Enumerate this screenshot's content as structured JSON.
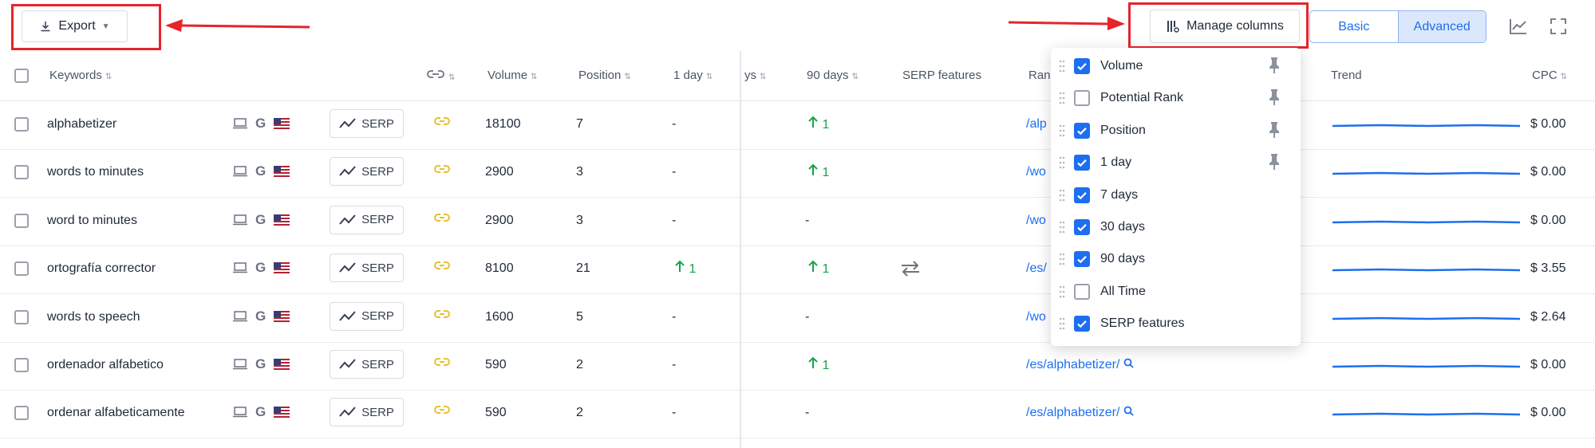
{
  "toolbar": {
    "export_label": "Export",
    "manage_columns_label": "Manage columns",
    "mode_basic": "Basic",
    "mode_advanced": "Advanced",
    "accent": "#1d6ef0"
  },
  "headers": {
    "keywords": "Keywords",
    "volume": "Volume",
    "position": "Position",
    "day1": "1 day",
    "days_partial": "ys",
    "days90": "90 days",
    "serp_features": "SERP features",
    "rank_partial": "Ran",
    "trend": "Trend",
    "cpc": "CPC"
  },
  "serp_label": "SERP",
  "rows": [
    {
      "keyword": "alphabetizer",
      "volume": "18100",
      "position": "7",
      "day1": "-",
      "day1_up": "",
      "days90": "",
      "days90_up": "1",
      "serp_swap": false,
      "url": "/alp",
      "cpc": "$ 0.00"
    },
    {
      "keyword": "words to minutes",
      "volume": "2900",
      "position": "3",
      "day1": "-",
      "day1_up": "",
      "days90": "",
      "days90_up": "1",
      "serp_swap": false,
      "url": "/wo",
      "cpc": "$ 0.00"
    },
    {
      "keyword": "word to minutes",
      "volume": "2900",
      "position": "3",
      "day1": "-",
      "day1_up": "",
      "days90": "-",
      "days90_up": "",
      "serp_swap": false,
      "url": "/wo",
      "cpc": "$ 0.00"
    },
    {
      "keyword": "ortografía corrector",
      "volume": "8100",
      "position": "21",
      "day1": "",
      "day1_up": "1",
      "days90": "",
      "days90_up": "1",
      "serp_swap": true,
      "url": "/es/",
      "cpc": "$ 3.55"
    },
    {
      "keyword": "words to speech",
      "volume": "1600",
      "position": "5",
      "day1": "-",
      "day1_up": "",
      "days90": "-",
      "days90_up": "",
      "serp_swap": false,
      "url": "/wo",
      "cpc": "$ 2.64"
    },
    {
      "keyword": "ordenador alfabetico",
      "volume": "590",
      "position": "2",
      "day1": "-",
      "day1_up": "",
      "days90": "",
      "days90_up": "1",
      "serp_swap": false,
      "url": "/es/alphabetizer/",
      "cpc": "$ 0.00"
    },
    {
      "keyword": "ordenar alfabeticamente",
      "volume": "590",
      "position": "2",
      "day1": "-",
      "day1_up": "",
      "days90": "-",
      "days90_up": "",
      "serp_swap": false,
      "url": "/es/alphabetizer/",
      "cpc": "$ 0.00"
    }
  ],
  "manage_columns_menu": [
    {
      "label": "Volume",
      "checked": true,
      "pinned": true
    },
    {
      "label": "Potential Rank",
      "checked": false,
      "pinned": true
    },
    {
      "label": "Position",
      "checked": true,
      "pinned": true
    },
    {
      "label": "1 day",
      "checked": true,
      "pinned": true
    },
    {
      "label": "7 days",
      "checked": true,
      "pinned": false
    },
    {
      "label": "30 days",
      "checked": true,
      "pinned": false
    },
    {
      "label": "90 days",
      "checked": true,
      "pinned": false
    },
    {
      "label": "All Time",
      "checked": false,
      "pinned": false
    },
    {
      "label": "SERP features",
      "checked": true,
      "pinned": false
    }
  ]
}
